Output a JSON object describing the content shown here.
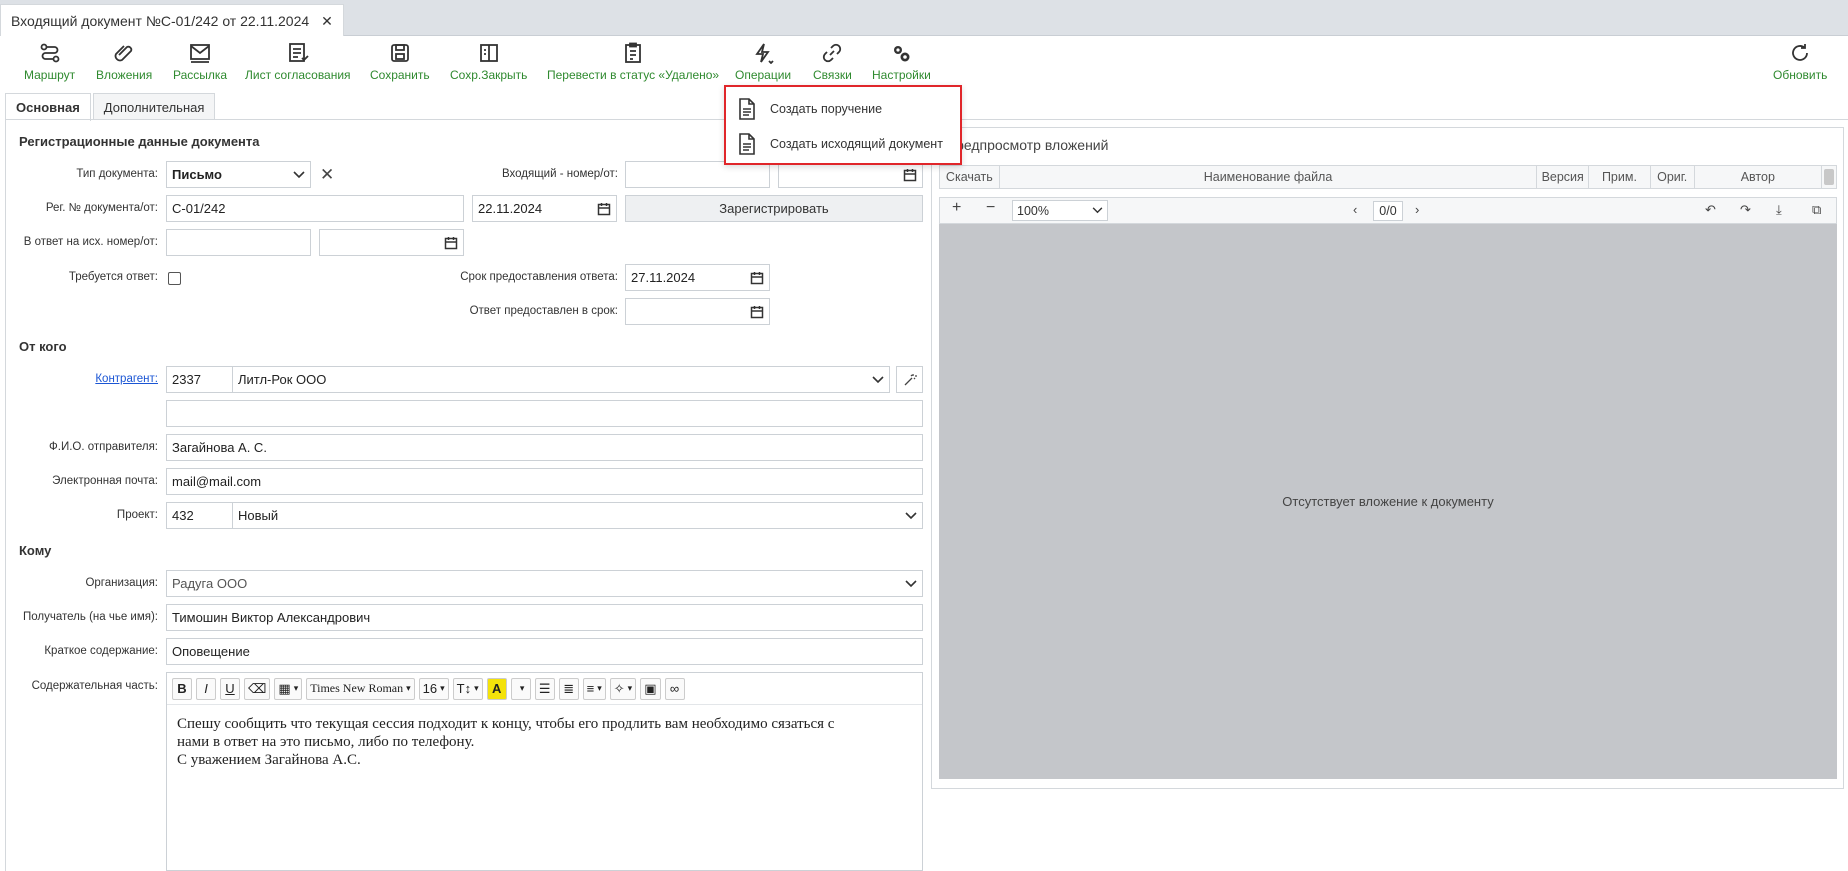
{
  "tab": {
    "title": "Входящий документ №С-01/242 от 22.11.2024"
  },
  "toolbar": {
    "route": "Маршрут",
    "attachments": "Вложения",
    "mailing": "Рассылка",
    "approval_sheet": "Лист согласования",
    "save": "Сохранить",
    "save_close": "Сохр.Закрыть",
    "to_deleted": "Перевести в статус «Удалено»",
    "operations": "Операции",
    "links": "Связки",
    "settings": "Настройки",
    "refresh": "Обновить"
  },
  "dropdown": {
    "create_order": "Создать поручение",
    "create_outgoing": "Создать исходящий документ"
  },
  "form_tabs": {
    "main": "Основная",
    "additional": "Дополнительная"
  },
  "reg": {
    "section": "Регистрационные данные документа",
    "doc_type_label": "Тип документа:",
    "doc_type_value": "Письмо",
    "incoming_label": "Входящий - номер/от:",
    "reg_label": "Рег. № документа/от:",
    "reg_number": "С-01/242",
    "reg_date": "22.11.2024",
    "register_button": "Зарегистрировать",
    "reply_to_label": "В ответ на исх. номер/от:",
    "reply_required_label": "Требуется ответ:",
    "deadline_label": "Срок предоставления ответа:",
    "deadline_value": "27.11.2024",
    "answered_label": "Ответ предоставлен в срок:"
  },
  "from": {
    "section": "От кого",
    "contractor_label": "Контрагент:",
    "contractor_code": "2337",
    "contractor_name": "Литл-Рок ООО",
    "sender_label": "Ф.И.О. отправителя:",
    "sender_value": "Загайнова А. С.",
    "email_label": "Электронная почта:",
    "email_value": "mail@mail.com",
    "project_label": "Проект:",
    "project_code": "432",
    "project_name": "Новый"
  },
  "to": {
    "section": "Кому",
    "org_label": "Организация:",
    "org_value": "Радуга ООО",
    "recipient_label": "Получатель (на чье имя):",
    "recipient_value": "Тимошин Виктор Александрович",
    "summary_label": "Краткое содержание:",
    "summary_value": "Оповещение",
    "content_label": "Содержательная часть:"
  },
  "editor": {
    "font": "Times New Roman",
    "size": "16",
    "line1": "Спешу сообщить что текущая сессия подходит к концу, чтобы его продлить вам необходимо сязаться с",
    "line2": "нами в ответ на это письмо, либо по телефону.",
    "line3": "С уважением Загайнова А.С."
  },
  "preview": {
    "title": "Предпросмотр вложений",
    "col_download": "Скачать",
    "col_name": "Наименование файла",
    "col_version": "Версия",
    "col_note": "Прим.",
    "col_orig": "Ориг.",
    "col_author": "Автор",
    "zoom": "100%",
    "page": "0/0",
    "empty": "Отсутствует вложение к документу"
  },
  "colors": {
    "toolbar_label": "#2f8a2f",
    "highlight_border": "#e0262a",
    "link": "#1a55d4"
  }
}
